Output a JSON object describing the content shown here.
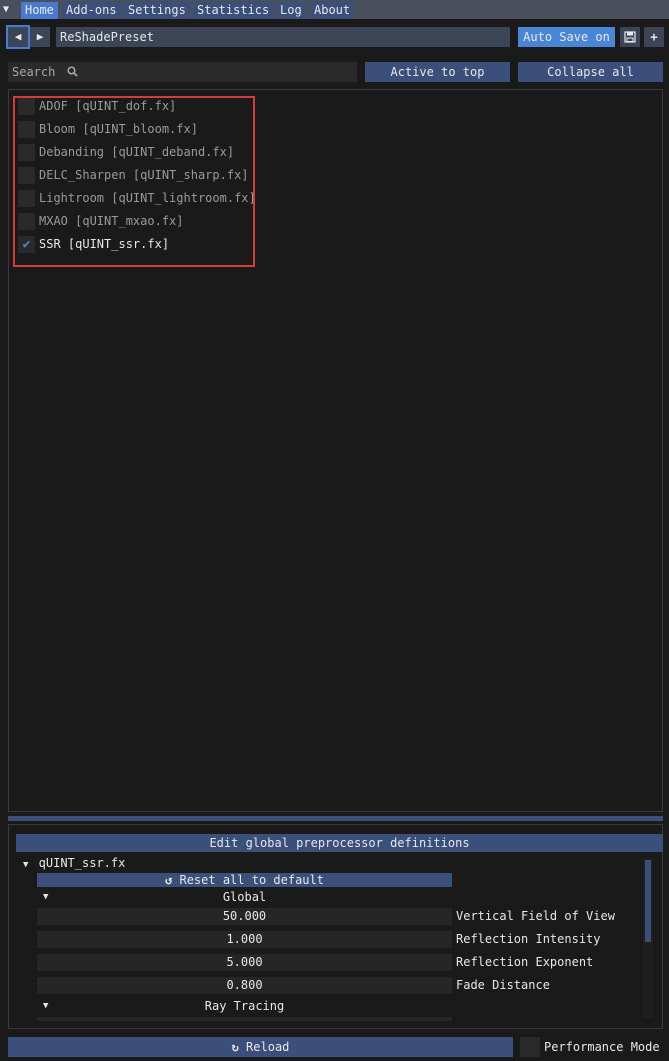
{
  "tabs": [
    {
      "label": "Home",
      "active": true
    },
    {
      "label": "Add-ons",
      "active": false
    },
    {
      "label": "Settings",
      "active": false
    },
    {
      "label": "Statistics",
      "active": false
    },
    {
      "label": "Log",
      "active": false
    },
    {
      "label": "About",
      "active": false
    }
  ],
  "toolbar": {
    "preset_name": "ReShadePreset",
    "auto_save_label": "Auto Save on",
    "prev_icon": "arrow-left-icon",
    "next_icon": "arrow-right-icon",
    "save_icon": "floppy-disk-icon",
    "add_icon": "plus-icon"
  },
  "search": {
    "placeholder": "Search"
  },
  "buttons": {
    "active_to_top": "Active to top",
    "collapse_all": "Collapse all"
  },
  "effects": [
    {
      "label": "ADOF [qUINT_dof.fx]",
      "checked": false
    },
    {
      "label": "Bloom [qUINT_bloom.fx]",
      "checked": false
    },
    {
      "label": "Debanding [qUINT_deband.fx]",
      "checked": false
    },
    {
      "label": "DELC_Sharpen [qUINT_sharp.fx]",
      "checked": false
    },
    {
      "label": "Lightroom [qUINT_lightroom.fx]",
      "checked": false
    },
    {
      "label": "MXAO [qUINT_mxao.fx]",
      "checked": false
    },
    {
      "label": "SSR [qUINT_ssr.fx]",
      "checked": true
    }
  ],
  "params": {
    "edit_global_label": "Edit global preprocessor definitions",
    "file_name": "qUINT_ssr.fx",
    "reset_label": "Reset all to default",
    "category_global": "Global",
    "category_ray": "Ray Tracing",
    "items": [
      {
        "value": "50.000",
        "label": "Vertical Field of View"
      },
      {
        "value": "1.000",
        "label": "Reflection Intensity"
      },
      {
        "value": "5.000",
        "label": "Reflection Exponent"
      },
      {
        "value": "0.800",
        "label": "Fade Distance"
      }
    ]
  },
  "footer": {
    "reload_label": "Reload",
    "performance_mode_label": "Performance Mode"
  },
  "colors": {
    "accent": "#4a86d6",
    "tab_active": "#4a7ad0",
    "button": "#3a4f7a",
    "highlight": "#d63a3a"
  }
}
